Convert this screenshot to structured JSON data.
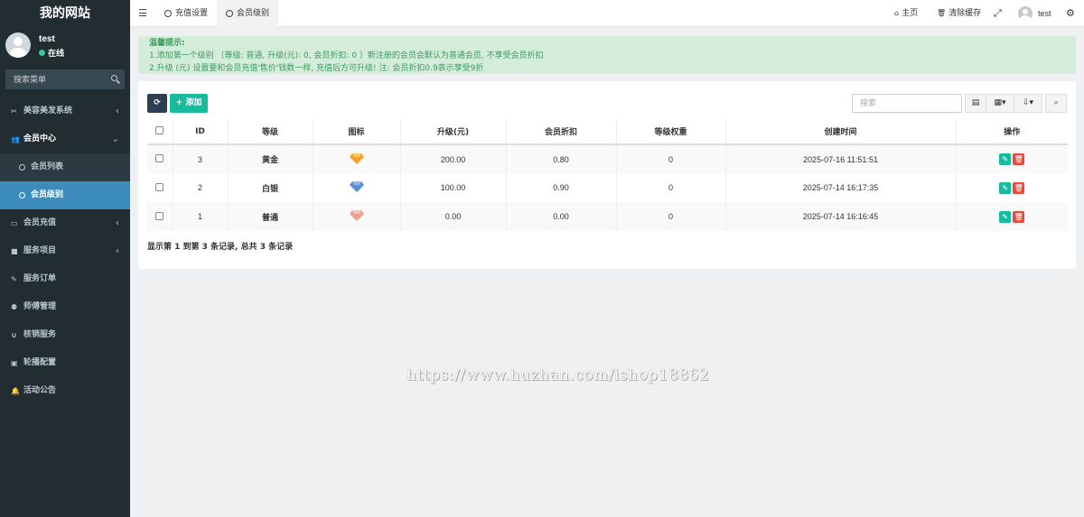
{
  "site": {
    "title": "我的网站"
  },
  "user": {
    "name": "test",
    "status": "在线"
  },
  "sidebar": {
    "search_placeholder": "搜索菜单",
    "items": [
      {
        "label": "美容美发系统",
        "icon": "scissors-icon"
      },
      {
        "label": "会员中心",
        "icon": "users-icon"
      },
      {
        "label": "会员充值",
        "icon": "credit-card-icon"
      },
      {
        "label": "服务项目",
        "icon": "briefcase-icon"
      },
      {
        "label": "服务订单",
        "icon": "edit-icon"
      },
      {
        "label": "师傅管理",
        "icon": "group-icon"
      },
      {
        "label": "核销服务",
        "icon": "magnet-icon"
      },
      {
        "label": "轮播配置",
        "icon": "window-icon"
      },
      {
        "label": "活动公告",
        "icon": "bell-icon"
      }
    ],
    "submenu": [
      {
        "label": "会员列表"
      },
      {
        "label": "会员级别"
      }
    ]
  },
  "topbar": {
    "tabs": [
      {
        "label": "充值设置"
      },
      {
        "label": "会员级别"
      }
    ],
    "home": "主页",
    "clear_cache": "清除缓存",
    "username": "test"
  },
  "alert": {
    "title": "温馨提示:",
    "line1": "1.添加第一个级别 〔等级: 普通, 升级(元): 0, 会员折扣: 0 〕新注册的会员会默认为普通会员, 不享受会员折扣",
    "line2": "2.升级 (元) 设置要和会员充值'售价'钱数一样, 充值后方可升级! 注: 会员折扣0.9表示享受9折"
  },
  "toolbar": {
    "add_label": "添加",
    "search_placeholder": "搜索"
  },
  "table": {
    "headers": [
      "ID",
      "等级",
      "图标",
      "升级(元)",
      "会员折扣",
      "等级权重",
      "创建时间",
      "操作"
    ],
    "rows": [
      {
        "id": "3",
        "level": "黄金",
        "icon_color": "#f0a52a",
        "upgrade": "200.00",
        "discount": "0.80",
        "weight": "0",
        "created": "2025-07-16 11:51:51"
      },
      {
        "id": "2",
        "level": "白银",
        "icon_color": "#5b8fd9",
        "upgrade": "100.00",
        "discount": "0.90",
        "weight": "0",
        "created": "2025-07-14 16:17:35"
      },
      {
        "id": "1",
        "level": "普通",
        "icon_color": "#f0a090",
        "upgrade": "0.00",
        "discount": "0.00",
        "weight": "0",
        "created": "2025-07-14 16:16:45"
      }
    ]
  },
  "pagination": {
    "info": "显示第 1 到第 3 条记录, 总共 3 条记录"
  },
  "watermark": "https://www.huzhan.com/ishop18862"
}
